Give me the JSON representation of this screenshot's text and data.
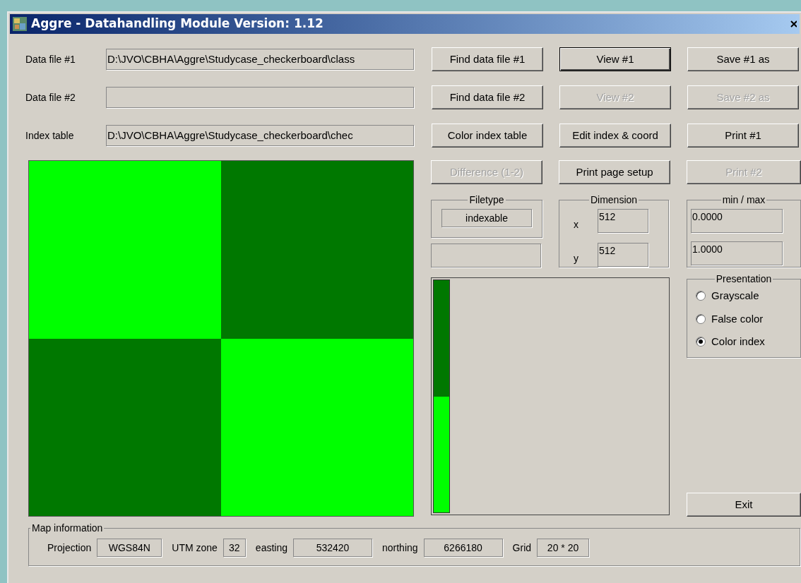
{
  "window": {
    "title": "Aggre - Datahandling Module Version: 1.12"
  },
  "files": [
    {
      "label": "Data file #1",
      "value": "D:\\JVO\\CBHA\\Aggre\\Studycase_checkerboard\\class"
    },
    {
      "label": "Data file #2"
    },
    {
      "label": "Index table",
      "value": "D:\\JVO\\CBHA\\Aggre\\Studycase_checkerboard\\chec"
    }
  ],
  "buttons": [
    {
      "label": "Find data file #1",
      "disabled": false,
      "default": false
    },
    {
      "label": "View #1",
      "disabled": false,
      "default": true
    },
    {
      "label": "Save #1 as",
      "disabled": false,
      "default": false
    },
    {
      "label": "Find data file #2",
      "disabled": false,
      "default": false
    },
    {
      "label": "View #2",
      "disabled": true,
      "default": false
    },
    {
      "label": "Save #2 as",
      "disabled": true,
      "default": false
    },
    {
      "label": "Color index table",
      "disabled": false,
      "default": false
    },
    {
      "label": "Edit index & coord",
      "disabled": false,
      "default": false
    },
    {
      "label": "Print #1",
      "disabled": false,
      "default": false
    },
    {
      "label": "Difference (1-2)",
      "disabled": true,
      "default": false
    },
    {
      "label": "Print page setup",
      "disabled": false,
      "default": false
    },
    {
      "label": "Print #2",
      "disabled": true,
      "default": false
    }
  ],
  "map": {
    "cells": [
      {
        "color": "#00ff00"
      },
      {
        "color": "#007800"
      },
      {
        "color": "#007800"
      },
      {
        "color": "#00ff00"
      }
    ]
  },
  "filetype": {
    "title": "Filetype",
    "value": "indexable"
  },
  "dimension": {
    "title": "Dimension",
    "fields": [
      {
        "label": "x",
        "value": "512"
      },
      {
        "label": "y",
        "value": "512"
      }
    ]
  },
  "min_max": {
    "title": "min / max",
    "values": [
      "0.0000",
      "1.0000"
    ]
  },
  "legend": [
    {
      "color": "#007800"
    },
    {
      "color": "#00ff00"
    }
  ],
  "presentation": {
    "title": "Presentation",
    "options": [
      {
        "label": "Grayscale",
        "selected": false
      },
      {
        "label": "False color",
        "selected": false
      },
      {
        "label": "Color index",
        "selected": true
      }
    ]
  },
  "exit_button": "Exit",
  "map_information": {
    "title": "Map information",
    "fields": [
      {
        "label": "Projection",
        "value": "WGS84N"
      },
      {
        "label": "UTM zone",
        "value": "32"
      },
      {
        "label": "easting",
        "value": "532420"
      },
      {
        "label": "northing",
        "value": "6266180"
      },
      {
        "label": "Grid",
        "value": "20 * 20"
      }
    ]
  }
}
